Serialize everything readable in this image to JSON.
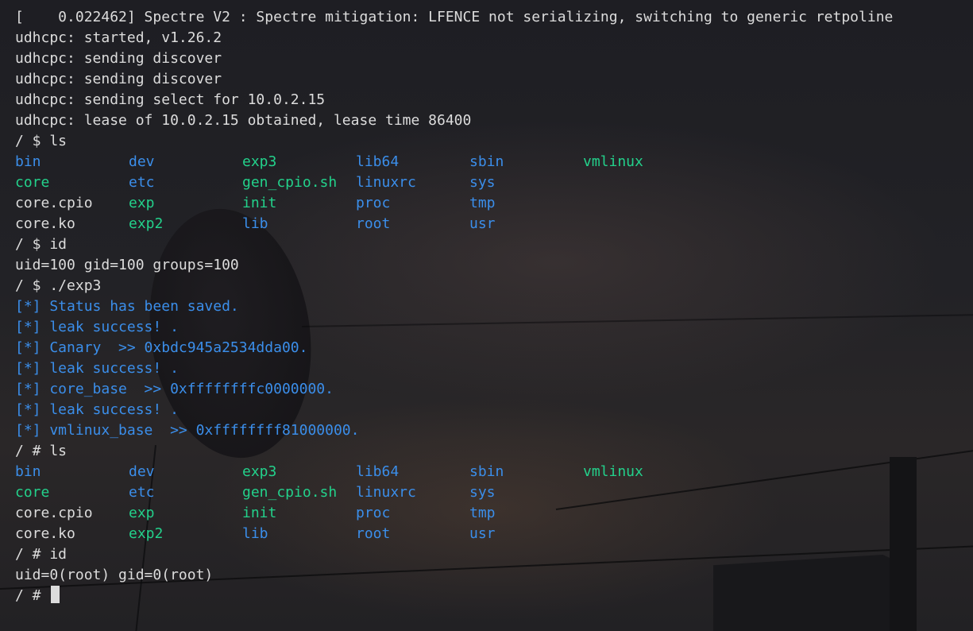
{
  "colors": {
    "directory": "#3b8eea",
    "executable": "#23d18b",
    "regular": "#dcdcdc",
    "info": "#3b8eea",
    "cursor": "#dcdcdc"
  },
  "boot_lines": [
    "[    0.022462] Spectre V2 : Spectre mitigation: LFENCE not serializing, switching to generic retpoline",
    "udhcpc: started, v1.26.2",
    "udhcpc: sending discover",
    "udhcpc: sending discover",
    "udhcpc: sending select for 10.0.2.15",
    "udhcpc: lease of 10.0.2.15 obtained, lease time 86400"
  ],
  "cmd_ls_1": "/ $ ls",
  "ls_listing_1": [
    [
      {
        "t": "bin",
        "k": "directory"
      },
      {
        "t": "dev",
        "k": "directory"
      },
      {
        "t": "exp3",
        "k": "executable"
      },
      {
        "t": "lib64",
        "k": "directory"
      },
      {
        "t": "sbin",
        "k": "directory"
      },
      {
        "t": "vmlinux",
        "k": "executable"
      }
    ],
    [
      {
        "t": "core",
        "k": "executable"
      },
      {
        "t": "etc",
        "k": "directory"
      },
      {
        "t": "gen_cpio.sh",
        "k": "executable"
      },
      {
        "t": "linuxrc",
        "k": "directory"
      },
      {
        "t": "sys",
        "k": "directory"
      }
    ],
    [
      {
        "t": "core.cpio",
        "k": "regular"
      },
      {
        "t": "exp",
        "k": "executable"
      },
      {
        "t": "init",
        "k": "executable"
      },
      {
        "t": "proc",
        "k": "directory"
      },
      {
        "t": "tmp",
        "k": "directory"
      }
    ],
    [
      {
        "t": "core.ko",
        "k": "regular"
      },
      {
        "t": "exp2",
        "k": "executable"
      },
      {
        "t": "lib",
        "k": "directory"
      },
      {
        "t": "root",
        "k": "directory"
      },
      {
        "t": "usr",
        "k": "directory"
      }
    ]
  ],
  "cmd_id_1": "/ $ id",
  "id_output_1": "uid=100 gid=100 groups=100",
  "cmd_exploit": "/ $ ./exp3",
  "exploit_output": [
    "[*] Status has been saved.",
    "[*] leak success! .",
    "[*] Canary  >> 0xbdc945a2534dda00.",
    "[*] leak success! .",
    "[*] core_base  >> 0xffffffffc0000000.",
    "[*] leak success! .",
    "[*] vmlinux_base  >> 0xffffffff81000000."
  ],
  "cmd_ls_2": "/ # ls",
  "ls_listing_2": [
    [
      {
        "t": "bin",
        "k": "directory"
      },
      {
        "t": "dev",
        "k": "directory"
      },
      {
        "t": "exp3",
        "k": "executable"
      },
      {
        "t": "lib64",
        "k": "directory"
      },
      {
        "t": "sbin",
        "k": "directory"
      },
      {
        "t": "vmlinux",
        "k": "executable"
      }
    ],
    [
      {
        "t": "core",
        "k": "executable"
      },
      {
        "t": "etc",
        "k": "directory"
      },
      {
        "t": "gen_cpio.sh",
        "k": "executable"
      },
      {
        "t": "linuxrc",
        "k": "directory"
      },
      {
        "t": "sys",
        "k": "directory"
      }
    ],
    [
      {
        "t": "core.cpio",
        "k": "regular"
      },
      {
        "t": "exp",
        "k": "executable"
      },
      {
        "t": "init",
        "k": "executable"
      },
      {
        "t": "proc",
        "k": "directory"
      },
      {
        "t": "tmp",
        "k": "directory"
      }
    ],
    [
      {
        "t": "core.ko",
        "k": "regular"
      },
      {
        "t": "exp2",
        "k": "executable"
      },
      {
        "t": "lib",
        "k": "directory"
      },
      {
        "t": "root",
        "k": "directory"
      },
      {
        "t": "usr",
        "k": "directory"
      }
    ]
  ],
  "cmd_id_2": "/ # id",
  "id_output_2": "uid=0(root) gid=0(root)",
  "prompt_current": "/ # "
}
